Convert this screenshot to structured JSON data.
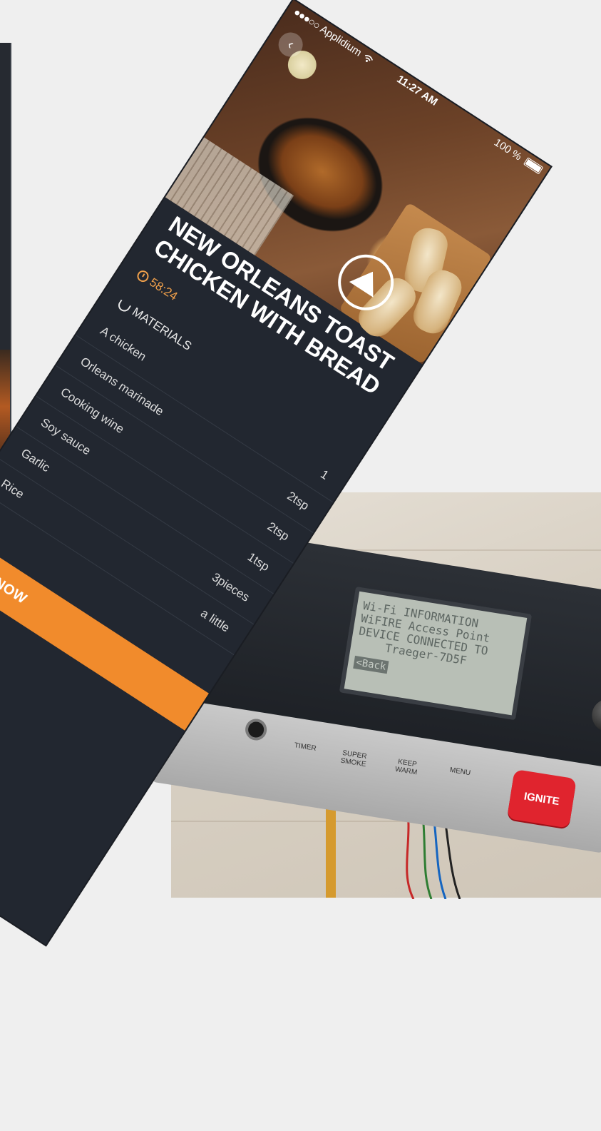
{
  "status_bar": {
    "carrier": "Applidium",
    "time": "11:27 AM",
    "battery": "100 %"
  },
  "recipe": {
    "title": "NEW ORLEANS TOAST CHICKEN WITH BREAD",
    "duration": "58:24",
    "materials_heading": "MATERIALS",
    "ingredients": [
      {
        "name": "A chicken",
        "qty": "1"
      },
      {
        "name": "Orleans marinade",
        "qty": "2tsp"
      },
      {
        "name": "Cooking wine",
        "qty": "2tsp"
      },
      {
        "name": "Soy sauce",
        "qty": "1tsp"
      },
      {
        "name": "Garlic",
        "qty": "3pieces"
      },
      {
        "name": "Rice",
        "qty": "a little"
      }
    ],
    "cta_label": "MAKE NOW"
  },
  "grill_controller": {
    "lcd_lines": [
      "Wi-Fi INFORMATION",
      "WiFIRE Access Point",
      "DEVICE CONNECTED TO",
      "Traeger-7D5F"
    ],
    "lcd_back": "<Back",
    "buttons": [
      "TIMER",
      "SUPER SMOKE",
      "KEEP WARM",
      "MENU"
    ],
    "ignite_label": "IGNITE"
  },
  "colors": {
    "screen_bg": "#222730",
    "accent_orange": "#f18b2c",
    "ignite_red": "#e0242e"
  },
  "icons": [
    "back-chevron-icon",
    "play-icon",
    "clock-icon",
    "bowl-icon",
    "battery-icon",
    "signal-icon",
    "wifi-icon"
  ]
}
